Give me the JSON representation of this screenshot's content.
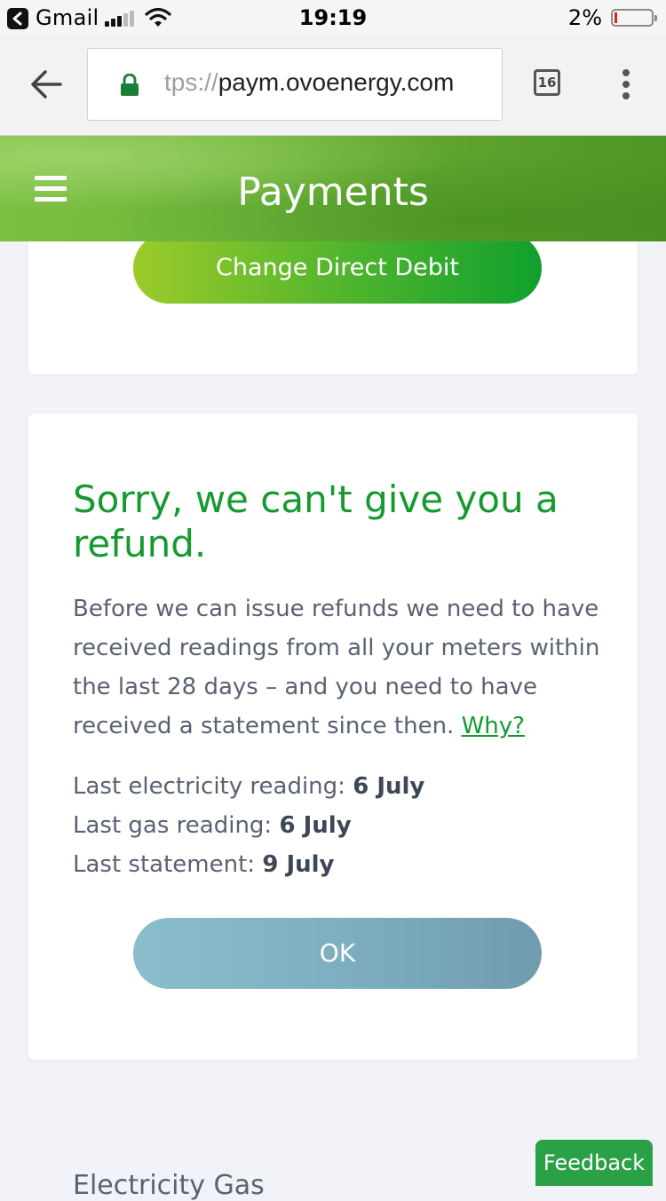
{
  "status_bar": {
    "back_app": "Gmail",
    "time": "19:19",
    "battery_percent": "2%",
    "battery_level": 0.02
  },
  "browser": {
    "url_prefix": "tps://",
    "url_host": "paym.ovoenergy.com",
    "tab_count": "16"
  },
  "header": {
    "title": "Payments"
  },
  "direct_debit_card": {
    "button_label": "Change Direct Debit"
  },
  "refund_card": {
    "heading": "Sorry, we can't give you a refund.",
    "body": "Before we can issue refunds we need to have received readings from all your meters within the last 28 days – and you need to have received a statement since then.",
    "why_link": "Why?",
    "readings": [
      {
        "label": "Last electricity reading:",
        "value": "6 July"
      },
      {
        "label": "Last gas reading:",
        "value": "6 July"
      },
      {
        "label": "Last statement:",
        "value": "9 July"
      }
    ],
    "ok_button": "OK"
  },
  "bottom": {
    "partial_text": "Electricity  Gas"
  },
  "feedback": {
    "label": "Feedback"
  },
  "colors": {
    "accent_green": "#149a2f",
    "body_text": "#5a6172",
    "ok_button": "#7eafc0",
    "feedback_bg": "#2aa147"
  }
}
